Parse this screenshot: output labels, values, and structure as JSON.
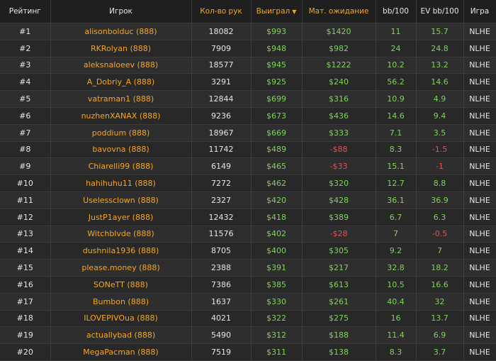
{
  "colors": {
    "accent": "#f5a623",
    "positive": "#7fd45a",
    "negative": "#e65050"
  },
  "headers": {
    "rank": "Рейтинг",
    "player": "Игрок",
    "hands": "Кол-во рук",
    "won": "Выиграл",
    "won_sort_icon": "▼",
    "ev": "Мат. ожидание",
    "bb100": "bb/100",
    "evbb100": "EV bb/100",
    "game": "Игра"
  },
  "rows": [
    {
      "rank": "#1",
      "player": "alisonbolduc (888)",
      "hands": "18082",
      "won": "$993",
      "ev": "$1420",
      "bb100": "11",
      "evbb100": "15.7",
      "game": "NLHE"
    },
    {
      "rank": "#2",
      "player": "RKRolyan (888)",
      "hands": "7909",
      "won": "$948",
      "ev": "$982",
      "bb100": "24",
      "evbb100": "24.8",
      "game": "NLHE"
    },
    {
      "rank": "#3",
      "player": "aleksnaloeev (888)",
      "hands": "18577",
      "won": "$945",
      "ev": "$1222",
      "bb100": "10.2",
      "evbb100": "13.2",
      "game": "NLHE"
    },
    {
      "rank": "#4",
      "player": "A_Dobriy_A (888)",
      "hands": "3291",
      "won": "$925",
      "ev": "$240",
      "bb100": "56.2",
      "evbb100": "14.6",
      "game": "NLHE"
    },
    {
      "rank": "#5",
      "player": "vatraman1 (888)",
      "hands": "12844",
      "won": "$699",
      "ev": "$316",
      "bb100": "10.9",
      "evbb100": "4.9",
      "game": "NLHE"
    },
    {
      "rank": "#6",
      "player": "nuzhenXANAX (888)",
      "hands": "9236",
      "won": "$673",
      "ev": "$436",
      "bb100": "14.6",
      "evbb100": "9.4",
      "game": "NLHE"
    },
    {
      "rank": "#7",
      "player": "poddium (888)",
      "hands": "18967",
      "won": "$669",
      "ev": "$333",
      "bb100": "7.1",
      "evbb100": "3.5",
      "game": "NLHE"
    },
    {
      "rank": "#8",
      "player": "bavovna (888)",
      "hands": "11742",
      "won": "$489",
      "ev": "-$88",
      "bb100": "8.3",
      "evbb100": "-1.5",
      "game": "NLHE"
    },
    {
      "rank": "#9",
      "player": "Chiarelli99 (888)",
      "hands": "6149",
      "won": "$465",
      "ev": "-$33",
      "bb100": "15.1",
      "evbb100": "-1",
      "game": "NLHE"
    },
    {
      "rank": "#10",
      "player": "hahihuhu11 (888)",
      "hands": "7272",
      "won": "$462",
      "ev": "$320",
      "bb100": "12.7",
      "evbb100": "8.8",
      "game": "NLHE"
    },
    {
      "rank": "#11",
      "player": "Uselessclown (888)",
      "hands": "2327",
      "won": "$420",
      "ev": "$428",
      "bb100": "36.1",
      "evbb100": "36.9",
      "game": "NLHE"
    },
    {
      "rank": "#12",
      "player": "JustP1ayer (888)",
      "hands": "12432",
      "won": "$418",
      "ev": "$389",
      "bb100": "6.7",
      "evbb100": "6.3",
      "game": "NLHE"
    },
    {
      "rank": "#13",
      "player": "Witchblvde (888)",
      "hands": "11576",
      "won": "$402",
      "ev": "-$28",
      "bb100": "7",
      "evbb100": "-0.5",
      "game": "NLHE"
    },
    {
      "rank": "#14",
      "player": "dushnila1936 (888)",
      "hands": "8705",
      "won": "$400",
      "ev": "$305",
      "bb100": "9.2",
      "evbb100": "7",
      "game": "NLHE"
    },
    {
      "rank": "#15",
      "player": "please.money (888)",
      "hands": "2388",
      "won": "$391",
      "ev": "$217",
      "bb100": "32.8",
      "evbb100": "18.2",
      "game": "NLHE"
    },
    {
      "rank": "#16",
      "player": "SONeTT (888)",
      "hands": "7386",
      "won": "$385",
      "ev": "$613",
      "bb100": "10.5",
      "evbb100": "16.6",
      "game": "NLHE"
    },
    {
      "rank": "#17",
      "player": "Bumbon (888)",
      "hands": "1637",
      "won": "$330",
      "ev": "$261",
      "bb100": "40.4",
      "evbb100": "32",
      "game": "NLHE"
    },
    {
      "rank": "#18",
      "player": "ILOVEPIVOua (888)",
      "hands": "4021",
      "won": "$322",
      "ev": "$275",
      "bb100": "16",
      "evbb100": "13.7",
      "game": "NLHE"
    },
    {
      "rank": "#19",
      "player": "actuallybad (888)",
      "hands": "5490",
      "won": "$312",
      "ev": "$188",
      "bb100": "11.4",
      "evbb100": "6.9",
      "game": "NLHE"
    },
    {
      "rank": "#20",
      "player": "MegaPacman (888)",
      "hands": "7519",
      "won": "$311",
      "ev": "$138",
      "bb100": "8.3",
      "evbb100": "3.7",
      "game": "NLHE"
    }
  ]
}
